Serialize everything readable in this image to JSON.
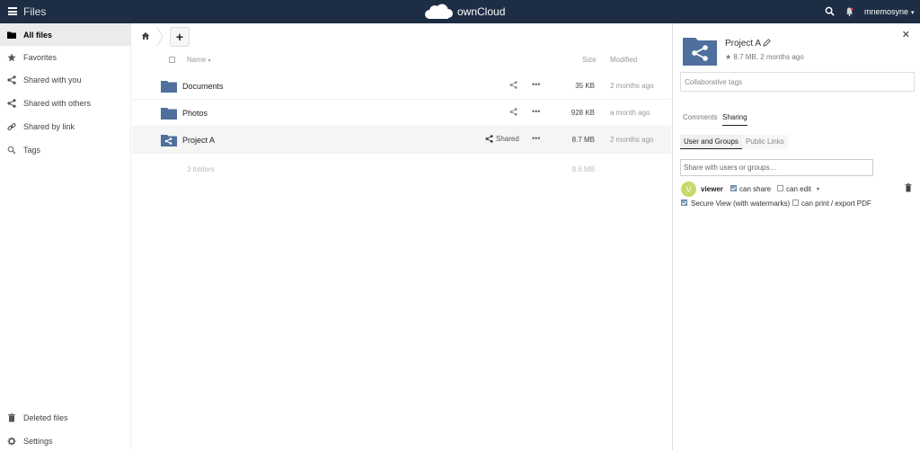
{
  "header": {
    "app_title": "Files",
    "logo_text": "ownCloud",
    "username": "mnemosyne"
  },
  "sidebar": {
    "items": [
      {
        "label": "All files",
        "icon": "folder-icon",
        "active": true
      },
      {
        "label": "Favorites",
        "icon": "star-icon"
      },
      {
        "label": "Shared with you",
        "icon": "share-icon"
      },
      {
        "label": "Shared with others",
        "icon": "share-icon"
      },
      {
        "label": "Shared by link",
        "icon": "link-icon"
      },
      {
        "label": "Tags",
        "icon": "tag-icon"
      }
    ],
    "bottom": [
      {
        "label": "Deleted files",
        "icon": "trash-icon"
      },
      {
        "label": "Settings",
        "icon": "gear-icon"
      }
    ]
  },
  "table": {
    "headers": {
      "name": "Name",
      "size": "Size",
      "modified": "Modified"
    },
    "rows": [
      {
        "name": "Documents",
        "size": "35 KB",
        "modified": "2 months ago",
        "shared_label": "",
        "icon": "folder-icon"
      },
      {
        "name": "Photos",
        "size": "928 KB",
        "modified": "a month ago",
        "shared_label": "",
        "icon": "folder-icon"
      },
      {
        "name": "Project A",
        "size": "8.7 MB",
        "modified": "2 months ago",
        "shared_label": "Shared",
        "icon": "shared-folder-icon"
      }
    ],
    "summary": {
      "count": "3 folders",
      "size": "9.6 MB"
    }
  },
  "details": {
    "title": "Project A",
    "meta": "8.7 MB, 2 months ago",
    "tags_placeholder": "Collaborative tags",
    "tabs": [
      "Comments",
      "Sharing"
    ],
    "subtabs": [
      "User and Groups",
      "Public Links"
    ],
    "share_placeholder": "Share with users or groups…",
    "share": {
      "avatar_letter": "V",
      "user": "viewer",
      "can_share": "can share",
      "can_edit": "can edit",
      "secure_view": "Secure View (with watermarks)",
      "can_print": "can print / export PDF"
    }
  },
  "colors": {
    "topbar": "#1d2d44",
    "folder": "#4f6f9c",
    "avatar": "#c9d86a"
  }
}
